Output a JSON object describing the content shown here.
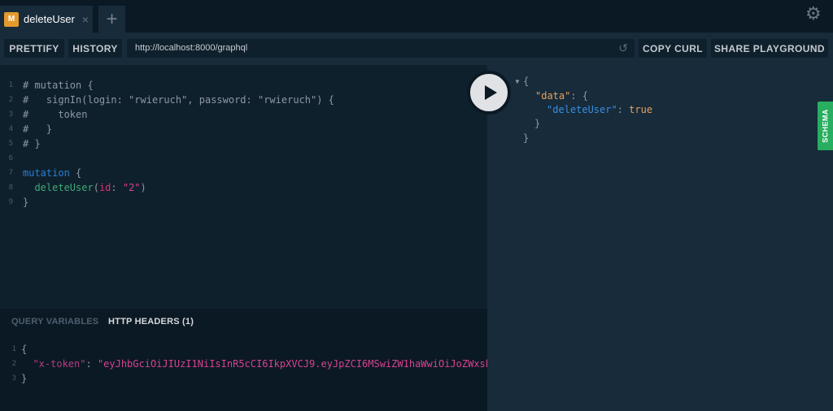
{
  "tabs": [
    {
      "badge": "M",
      "label": "deleteUser",
      "close": "×"
    }
  ],
  "tab_add_label": "+",
  "settings_icon": "⚙",
  "toolbar": {
    "prettify_label": "PRETTIFY",
    "history_label": "HISTORY",
    "url": "http://localhost:8000/graphql",
    "reload_icon": "↺",
    "copy_curl_label": "COPY CURL",
    "share_label": "SHARE PLAYGROUND"
  },
  "editor": {
    "lines": [
      {
        "n": "1",
        "text": "# mutation {"
      },
      {
        "n": "2",
        "text": "#   signIn(login: \"rwieruch\", password: \"rwieruch\") {"
      },
      {
        "n": "3",
        "text": "#     token"
      },
      {
        "n": "4",
        "text": "#   }"
      },
      {
        "n": "5",
        "text": "# }"
      },
      {
        "n": "6",
        "text": ""
      },
      {
        "n": "7",
        "kw": "mutation",
        "rest": " {"
      },
      {
        "n": "8",
        "indent": "  ",
        "field": "deleteUser",
        "open": "(",
        "arg": "id",
        "colon": ": ",
        "str": "\"2\"",
        "close": ")"
      },
      {
        "n": "9",
        "text": "}"
      }
    ]
  },
  "bottom_panel": {
    "tab_variables": "QUERY VARIABLES",
    "tab_headers": "HTTP HEADERS (1)",
    "lines": [
      {
        "n": "1",
        "text": "{"
      },
      {
        "n": "2",
        "key": "\"x-token\"",
        "colon": ": ",
        "value": "\"eyJhbGciOiJIUzI1NiIsInR5cCI6IkpXVCJ9.eyJpZCI6MSwiZW1haWwiOiJoZWxsb"
      },
      {
        "n": "3",
        "text": "}"
      }
    ]
  },
  "result": {
    "lines": [
      {
        "text": "{"
      },
      {
        "key": "\"data\"",
        "rest": ": {"
      },
      {
        "key": "\"deleteUser\"",
        "colon": ": ",
        "value": "true"
      },
      {
        "text": "}"
      },
      {
        "text": "}"
      }
    ]
  },
  "schema_label": "SCHEMA",
  "colors": {
    "accent_badge": "#e39a2c",
    "schema_green": "#27ae60"
  }
}
